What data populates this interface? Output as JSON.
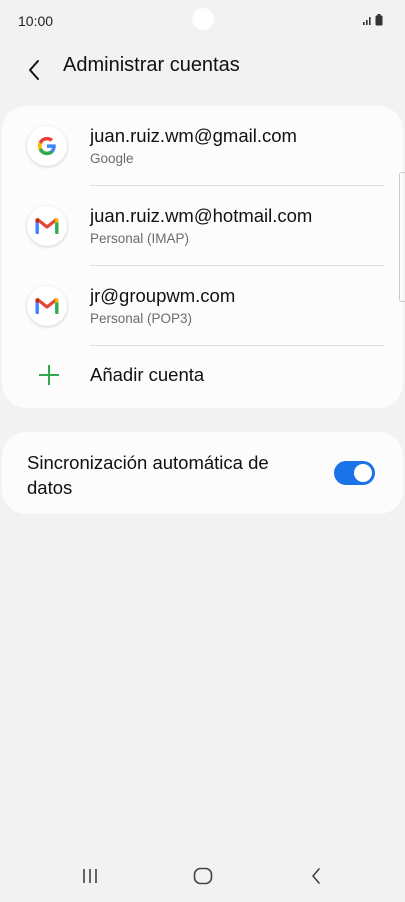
{
  "status_bar": {
    "time": "10:00"
  },
  "header": {
    "title": "Administrar cuentas"
  },
  "accounts": [
    {
      "email": "juan.ruiz.wm@gmail.com",
      "type": "Google",
      "icon": "google-icon"
    },
    {
      "email": "juan.ruiz.wm@hotmail.com",
      "type": "Personal (IMAP)",
      "icon": "gmail-icon"
    },
    {
      "email": "jr@groupwm.com",
      "type": "Personal (POP3)",
      "icon": "gmail-icon"
    }
  ],
  "add_account": {
    "label": "Añadir cuenta"
  },
  "sync": {
    "label": "Sincronización automática de datos",
    "enabled": true
  },
  "colors": {
    "accent": "#1a73e8",
    "add_icon": "#2fa84f",
    "background": "#f2f2f2"
  }
}
